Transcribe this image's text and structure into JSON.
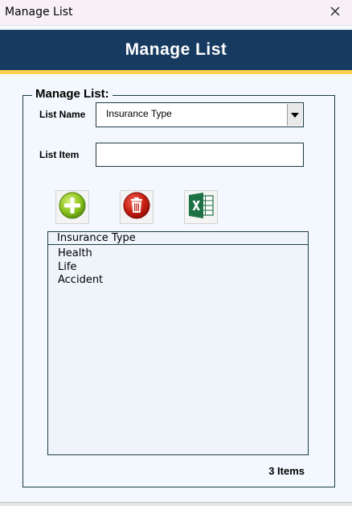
{
  "window": {
    "title": "Manage List"
  },
  "header": {
    "title": "Manage List"
  },
  "group": {
    "legend": "Manage List:"
  },
  "form": {
    "list_name_label": "List Name",
    "list_name_value": "Insurance Type",
    "list_item_label": "List Item",
    "list_item_value": ""
  },
  "toolbar": {
    "add_icon": "add-circle-icon",
    "delete_icon": "trash-icon",
    "export_icon": "excel-icon"
  },
  "list": {
    "header": "Insurance Type",
    "items": [
      "Health",
      "Life",
      "Accident"
    ]
  },
  "footer": {
    "count_text": "3 Items"
  },
  "colors": {
    "banner": "#163a60",
    "accent": "#ffd24a",
    "panel": "#f2f8fd"
  }
}
